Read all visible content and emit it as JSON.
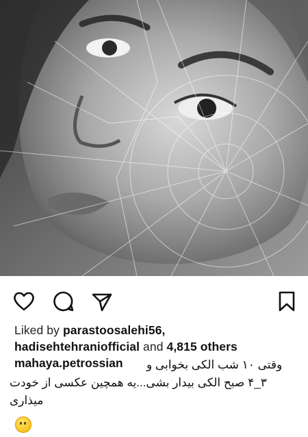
{
  "post": {
    "photo": {
      "subject": "black-and-white portrait photo with cracked-glass overlay"
    },
    "actions": {
      "like_icon": "heart-icon",
      "comment_icon": "comment-icon",
      "share_icon": "send-icon",
      "save_icon": "bookmark-icon"
    },
    "likes": {
      "prefix": "Liked by ",
      "user1": "parastoosalehi56,",
      "user2": "hadisehtehraniofficial",
      "and_text": " and ",
      "others": "4,815 others"
    },
    "caption": {
      "username": "mahaya.petrossian",
      "line1": "وقتی ۱۰ شب الکی بخوابی و",
      "line2": "۳_۴ صبح الکی بیدار بشی...یه همچین عکسی از خودت",
      "line3": "میذاری",
      "emoji": "😶"
    }
  },
  "colors": {
    "text": "#111111",
    "background": "#ffffff"
  }
}
